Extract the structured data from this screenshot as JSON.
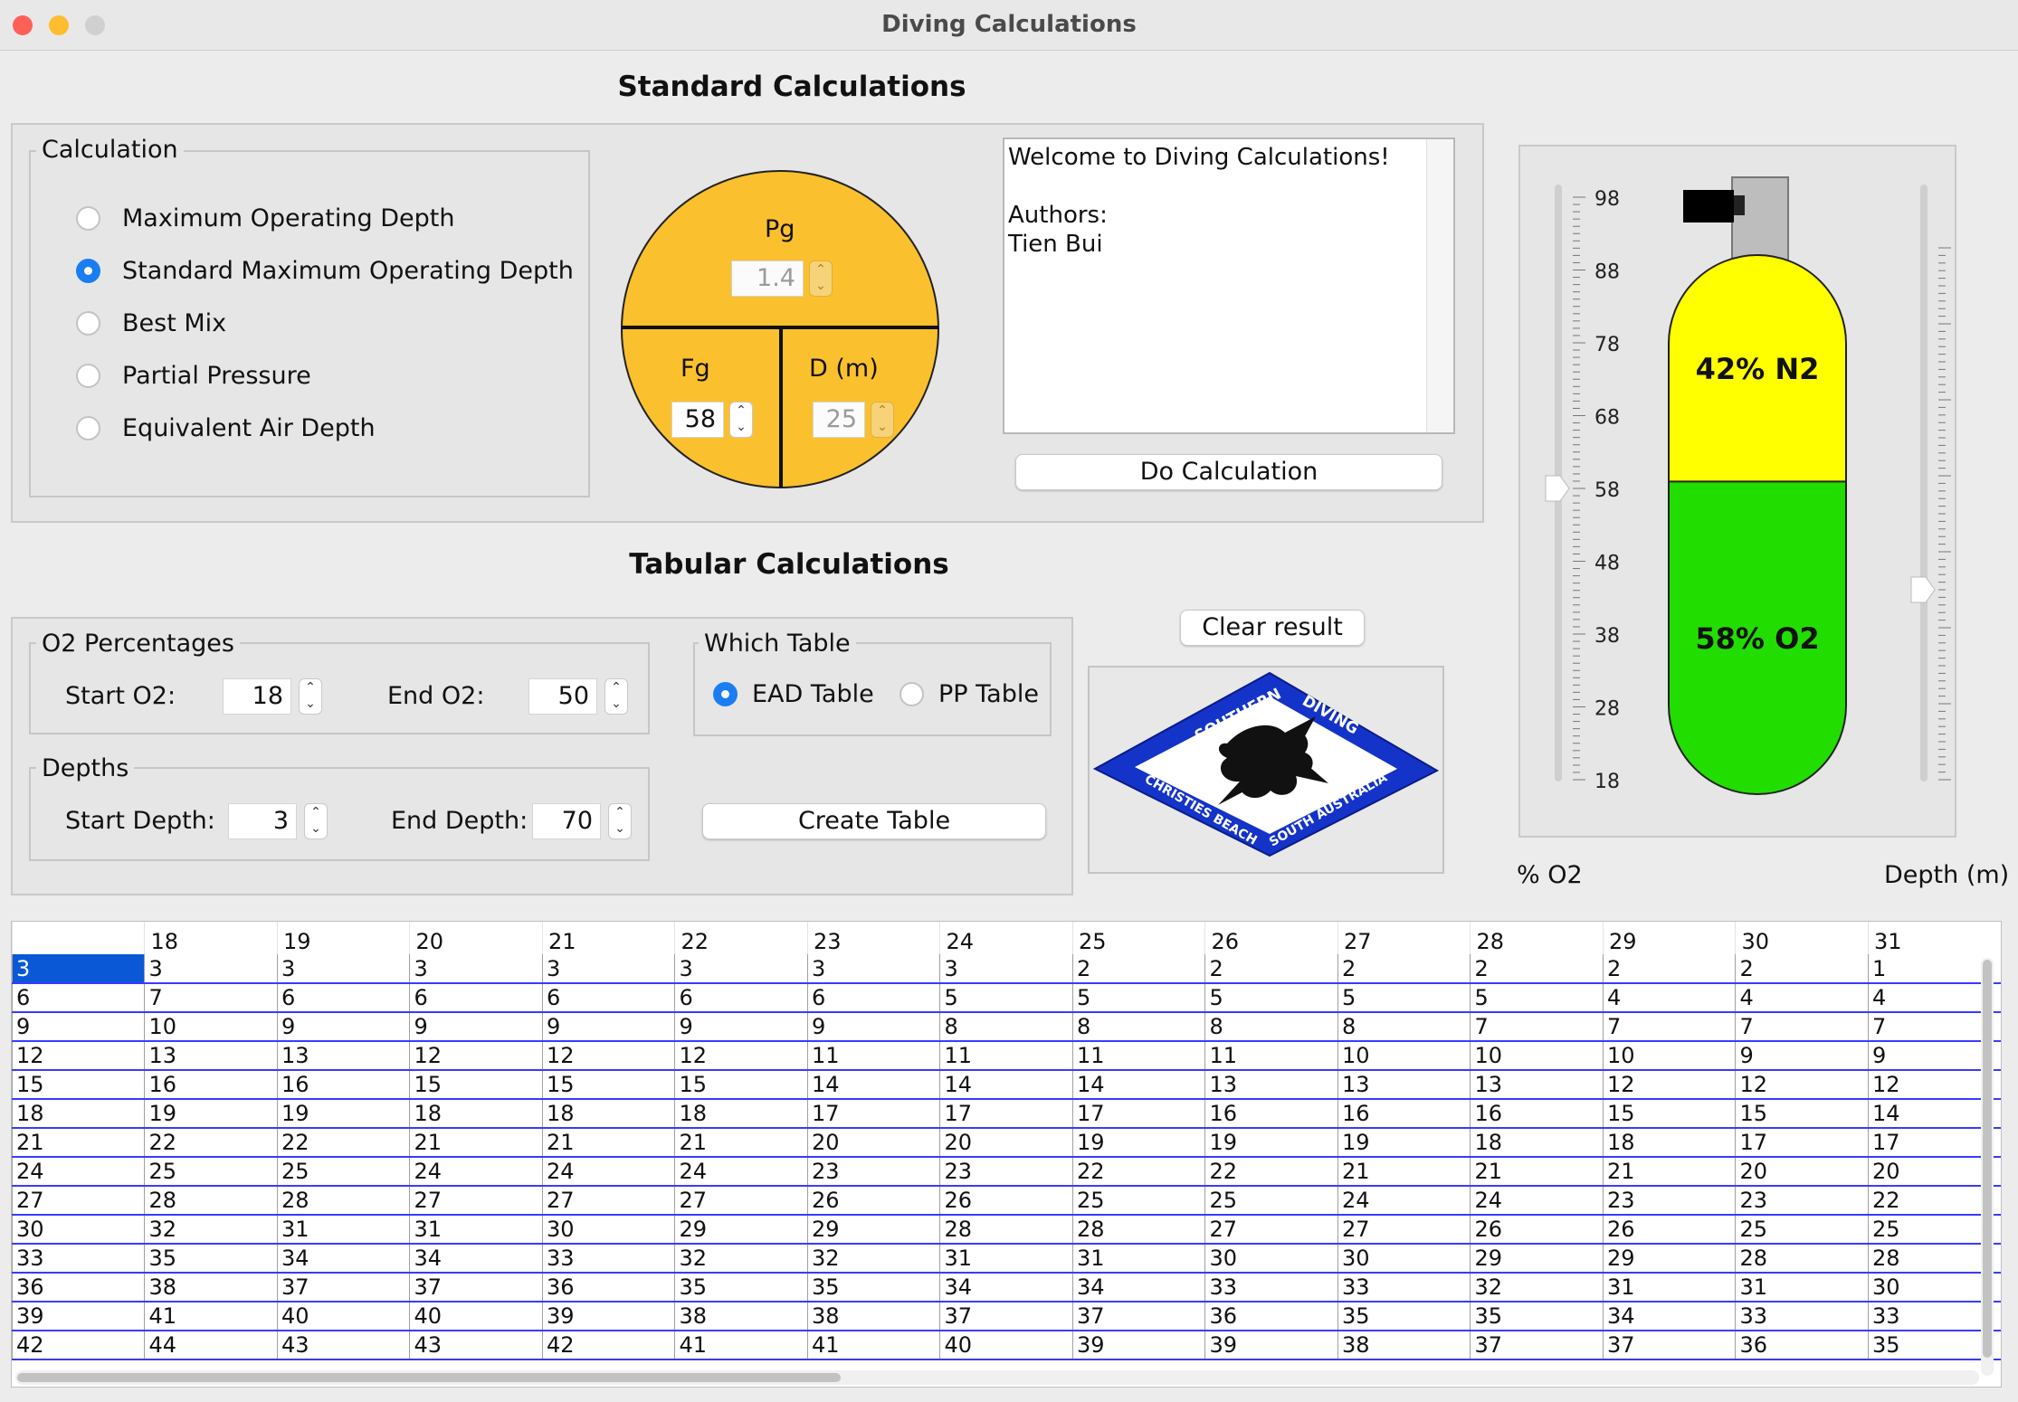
{
  "window": {
    "title": "Diving Calculations"
  },
  "standard": {
    "title": "Standard Calculations",
    "group_legend": "Calculation",
    "options": [
      {
        "label": "Maximum Operating Depth",
        "selected": false
      },
      {
        "label": "Standard Maximum Operating Depth",
        "selected": true
      },
      {
        "label": "Best Mix",
        "selected": false
      },
      {
        "label": "Partial Pressure",
        "selected": false
      },
      {
        "label": "Equivalent Air Depth",
        "selected": false
      }
    ],
    "circle": {
      "pg_label": "Pg",
      "pg_value": "1.4",
      "fg_label": "Fg",
      "fg_value": "58",
      "d_label": "D (m)",
      "d_value": "25",
      "color": "#fbc02d"
    },
    "output_text": "Welcome to Diving Calculations!\n\nAuthors:\nTien Bui",
    "do_calc_label": "Do Calculation"
  },
  "tank": {
    "n2_label": "42% N2",
    "o2_label": "58% O2",
    "n2_color": "#ffff00",
    "o2_color": "#22dd00",
    "o2_fraction": 0.58,
    "o2_slider_ticks": [
      "98",
      "88",
      "78",
      "68",
      "58",
      "48",
      "38",
      "28",
      "18"
    ],
    "o2_slider_value": 58,
    "depth_slider_ticks": [
      "70",
      "60",
      "50",
      "40",
      "30",
      "20",
      "10",
      "0"
    ],
    "depth_slider_value": 25,
    "o2_caption": "% O2",
    "depth_caption": "Depth (m)"
  },
  "tabular": {
    "title": "Tabular Calculations",
    "o2_legend": "O2 Percentages",
    "start_o2_label": "Start O2:",
    "start_o2_value": "18",
    "end_o2_label": "End O2:",
    "end_o2_value": "50",
    "depths_legend": "Depths",
    "start_depth_label": "Start Depth:",
    "start_depth_value": "3",
    "end_depth_label": "End Depth:",
    "end_depth_value": "70",
    "which_legend": "Which Table",
    "ead_label": "EAD Table",
    "ead_selected": true,
    "pp_label": "PP Table",
    "pp_selected": false,
    "create_label": "Create Table",
    "clear_label": "Clear result"
  },
  "logo": {
    "top_left": "SOUTHERN",
    "top_right": "DIVING",
    "bottom_left": "CHRISTIES BEACH",
    "bottom_right": "SOUTH AUSTRALIA",
    "color": "#1433c8"
  },
  "results": {
    "headers": [
      "",
      "18",
      "19",
      "20",
      "21",
      "22",
      "23",
      "24",
      "25",
      "26",
      "27",
      "28",
      "29",
      "30",
      "31"
    ],
    "rows": [
      [
        "3",
        "3",
        "3",
        "3",
        "3",
        "3",
        "3",
        "3",
        "2",
        "2",
        "2",
        "2",
        "2",
        "2",
        "1"
      ],
      [
        "6",
        "7",
        "6",
        "6",
        "6",
        "6",
        "6",
        "5",
        "5",
        "5",
        "5",
        "5",
        "4",
        "4",
        "4"
      ],
      [
        "9",
        "10",
        "9",
        "9",
        "9",
        "9",
        "9",
        "8",
        "8",
        "8",
        "8",
        "7",
        "7",
        "7",
        "7"
      ],
      [
        "12",
        "13",
        "13",
        "12",
        "12",
        "12",
        "11",
        "11",
        "11",
        "11",
        "10",
        "10",
        "10",
        "9",
        "9"
      ],
      [
        "15",
        "16",
        "16",
        "15",
        "15",
        "15",
        "14",
        "14",
        "14",
        "13",
        "13",
        "13",
        "12",
        "12",
        "12"
      ],
      [
        "18",
        "19",
        "19",
        "18",
        "18",
        "18",
        "17",
        "17",
        "17",
        "16",
        "16",
        "16",
        "15",
        "15",
        "14"
      ],
      [
        "21",
        "22",
        "22",
        "21",
        "21",
        "21",
        "20",
        "20",
        "19",
        "19",
        "19",
        "18",
        "18",
        "17",
        "17"
      ],
      [
        "24",
        "25",
        "25",
        "24",
        "24",
        "24",
        "23",
        "23",
        "22",
        "22",
        "21",
        "21",
        "21",
        "20",
        "20"
      ],
      [
        "27",
        "28",
        "28",
        "27",
        "27",
        "27",
        "26",
        "26",
        "25",
        "25",
        "24",
        "24",
        "23",
        "23",
        "22"
      ],
      [
        "30",
        "32",
        "31",
        "31",
        "30",
        "29",
        "29",
        "28",
        "28",
        "27",
        "27",
        "26",
        "26",
        "25",
        "25"
      ],
      [
        "33",
        "35",
        "34",
        "34",
        "33",
        "32",
        "32",
        "31",
        "31",
        "30",
        "30",
        "29",
        "29",
        "28",
        "28"
      ],
      [
        "36",
        "38",
        "37",
        "37",
        "36",
        "35",
        "35",
        "34",
        "34",
        "33",
        "33",
        "32",
        "31",
        "31",
        "30"
      ],
      [
        "39",
        "41",
        "40",
        "40",
        "39",
        "38",
        "38",
        "37",
        "37",
        "36",
        "35",
        "35",
        "34",
        "33",
        "33"
      ],
      [
        "42",
        "44",
        "43",
        "43",
        "42",
        "41",
        "41",
        "40",
        "39",
        "39",
        "38",
        "37",
        "37",
        "36",
        "35"
      ]
    ]
  }
}
